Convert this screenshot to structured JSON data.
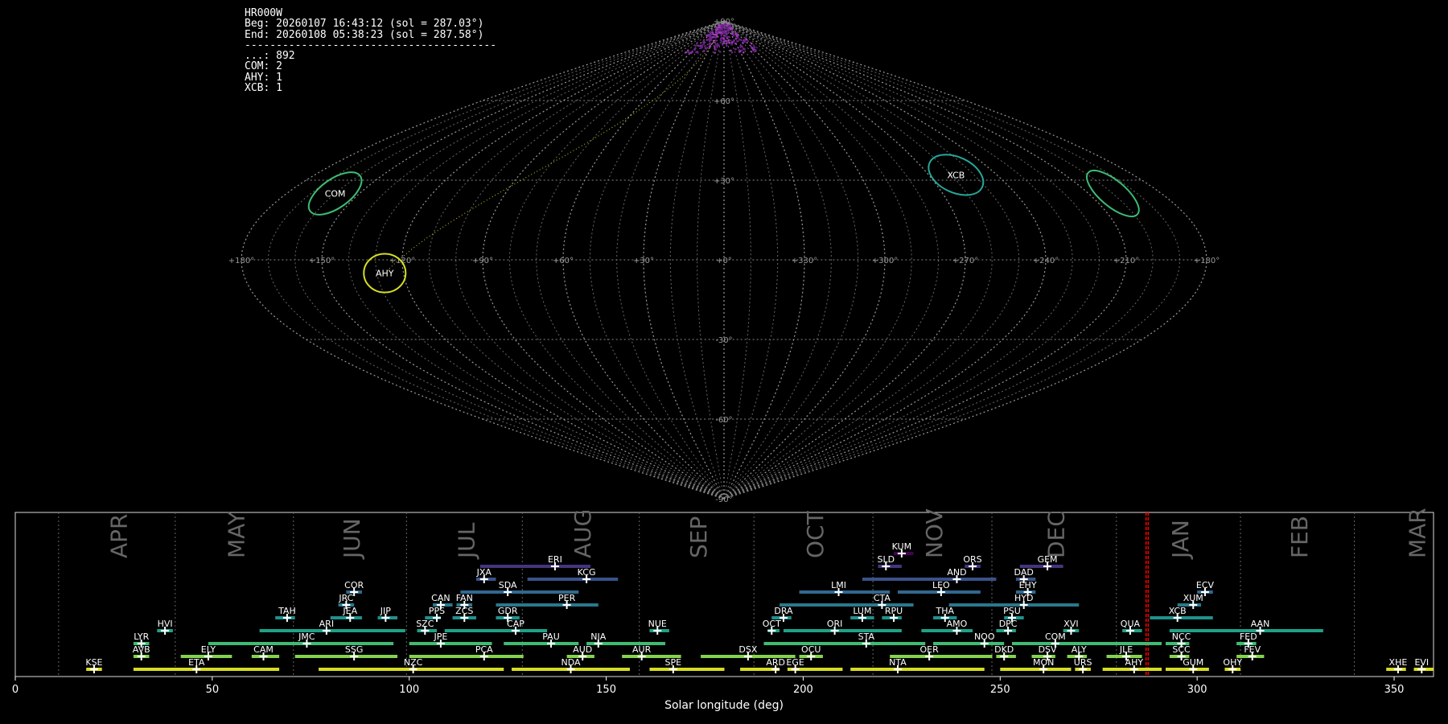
{
  "info": {
    "header_lines": [
      "HR000W",
      "Beg: 20260107 16:43:12 (sol = 287.03°)",
      "End: 20260108 05:38:23 (sol = 287.58°)",
      "----------------------------------------"
    ],
    "counts": [
      {
        "code": "...",
        "count": 892
      },
      {
        "code": "COM",
        "count": 2
      },
      {
        "code": "AHY",
        "count": 1
      },
      {
        "code": "XCB",
        "count": 1
      }
    ]
  },
  "sky_map": {
    "projection": "sinusoidal",
    "lon_ticks": [
      "+180°",
      "+150°",
      "+120°",
      "+90°",
      "+60°",
      "+30°",
      "+0°",
      "+330°",
      "+300°",
      "+270°",
      "+240°",
      "+210°",
      "+180°"
    ],
    "lat_ticks": [
      "+90°",
      "+60°",
      "+30°",
      "-30°",
      "-60°",
      "-90°"
    ],
    "radiants": [
      {
        "code": "COM",
        "lon": 160,
        "lat": 25,
        "color": "#3dbc74"
      },
      {
        "code": "AHY",
        "lon": 127,
        "lat": -5,
        "color": "#d6dd22"
      },
      {
        "code": "XCB",
        "lon": 258,
        "lat": 32,
        "color": "#26a69a"
      },
      {
        "code": "",
        "lon": 200,
        "lat": 25,
        "color": "#3dbc74"
      }
    ]
  },
  "timeline": {
    "month_labels": [
      "APR",
      "MAY",
      "JUN",
      "JUL",
      "AUG",
      "SEP",
      "OCT",
      "NOV",
      "DEC",
      "JAN",
      "FEB",
      "MAR"
    ],
    "month_boundaries": [
      11.0,
      40.6,
      70.6,
      99.3,
      128.7,
      158.4,
      187.5,
      217.7,
      247.9,
      279.5,
      311.0,
      339.9
    ],
    "current_sol": [
      287.03,
      287.58
    ]
  },
  "chart_data": {
    "type": "timeline",
    "xlabel": "Solar longitude (deg)",
    "xlim": [
      0,
      360
    ],
    "xticks": [
      0,
      50,
      100,
      150,
      200,
      250,
      300,
      350
    ],
    "showers": [
      {
        "code": "KSE",
        "start": 18,
        "end": 22,
        "peak": 20,
        "row": 0,
        "color": "#d6dd22"
      },
      {
        "code": "ETA",
        "start": 30,
        "end": 67,
        "peak": 46,
        "row": 0,
        "color": "#d6dd22"
      },
      {
        "code": "NZC",
        "start": 77,
        "end": 124,
        "peak": 101,
        "row": 0,
        "color": "#d6dd22"
      },
      {
        "code": "NDA",
        "start": 126,
        "end": 156,
        "peak": 141,
        "row": 0,
        "color": "#d6dd22"
      },
      {
        "code": "SPE",
        "start": 161,
        "end": 180,
        "peak": 167,
        "row": 0,
        "color": "#d6dd22"
      },
      {
        "code": "ARD",
        "start": 184,
        "end": 194,
        "peak": 193,
        "row": 0,
        "color": "#d6dd22"
      },
      {
        "code": "EGE",
        "start": 196,
        "end": 210,
        "peak": 198,
        "row": 0,
        "color": "#d6dd22"
      },
      {
        "code": "NTA",
        "start": 212,
        "end": 246,
        "peak": 224,
        "row": 0,
        "color": "#d6dd22"
      },
      {
        "code": "MON",
        "start": 250,
        "end": 268,
        "peak": 261,
        "row": 0,
        "color": "#d6dd22"
      },
      {
        "code": "URS",
        "start": 269,
        "end": 273,
        "peak": 271,
        "row": 0,
        "color": "#d6dd22"
      },
      {
        "code": "AHY",
        "start": 276,
        "end": 291,
        "peak": 284,
        "row": 0,
        "color": "#d6dd22"
      },
      {
        "code": "GUM",
        "start": 292,
        "end": 303,
        "peak": 299,
        "row": 0,
        "color": "#d6dd22"
      },
      {
        "code": "OHY",
        "start": 307,
        "end": 311,
        "peak": 309,
        "row": 0,
        "color": "#d6dd22"
      },
      {
        "code": "XHE",
        "start": 348,
        "end": 353,
        "peak": 351,
        "row": 0,
        "color": "#d6dd22"
      },
      {
        "code": "EVI",
        "start": 355,
        "end": 360,
        "peak": 357,
        "row": 0,
        "color": "#d6dd22"
      },
      {
        "code": "AVB",
        "start": 30,
        "end": 34,
        "peak": 32,
        "row": 1,
        "color": "#84d44b"
      },
      {
        "code": "ELY",
        "start": 42,
        "end": 55,
        "peak": 49,
        "row": 1,
        "color": "#84d44b"
      },
      {
        "code": "CAM",
        "start": 60,
        "end": 67,
        "peak": 63,
        "row": 1,
        "color": "#84d44b"
      },
      {
        "code": "SSG",
        "start": 71,
        "end": 97,
        "peak": 86,
        "row": 1,
        "color": "#84d44b"
      },
      {
        "code": "PCA",
        "start": 100,
        "end": 129,
        "peak": 119,
        "row": 1,
        "color": "#84d44b"
      },
      {
        "code": "AUD",
        "start": 140,
        "end": 147,
        "peak": 144,
        "row": 1,
        "color": "#84d44b"
      },
      {
        "code": "AUR",
        "start": 154,
        "end": 169,
        "peak": 159,
        "row": 1,
        "color": "#84d44b"
      },
      {
        "code": "DSX",
        "start": 174,
        "end": 198,
        "peak": 186,
        "row": 1,
        "color": "#84d44b"
      },
      {
        "code": "OCU",
        "start": 199,
        "end": 205,
        "peak": 202,
        "row": 1,
        "color": "#84d44b"
      },
      {
        "code": "OER",
        "start": 222,
        "end": 248,
        "peak": 232,
        "row": 1,
        "color": "#84d44b"
      },
      {
        "code": "DKD",
        "start": 249,
        "end": 254,
        "peak": 251,
        "row": 1,
        "color": "#84d44b"
      },
      {
        "code": "DSV",
        "start": 258,
        "end": 264,
        "peak": 262,
        "row": 1,
        "color": "#84d44b"
      },
      {
        "code": "ALY",
        "start": 267,
        "end": 272,
        "peak": 270,
        "row": 1,
        "color": "#84d44b"
      },
      {
        "code": "JLE",
        "start": 277,
        "end": 286,
        "peak": 282,
        "row": 1,
        "color": "#84d44b"
      },
      {
        "code": "SCC",
        "start": 293,
        "end": 298,
        "peak": 296,
        "row": 1,
        "color": "#84d44b"
      },
      {
        "code": "FEV",
        "start": 310,
        "end": 317,
        "peak": 314,
        "row": 1,
        "color": "#84d44b"
      },
      {
        "code": "LYR",
        "start": 30,
        "end": 34,
        "peak": 32,
        "row": 2,
        "color": "#3dbc74"
      },
      {
        "code": "JMC",
        "start": 49,
        "end": 96,
        "peak": 74,
        "row": 2,
        "color": "#3dbc74"
      },
      {
        "code": "JPE",
        "start": 100,
        "end": 121,
        "peak": 108,
        "row": 2,
        "color": "#3dbc74"
      },
      {
        "code": "PAU",
        "start": 124,
        "end": 143,
        "peak": 136,
        "row": 2,
        "color": "#3dbc74"
      },
      {
        "code": "NIA",
        "start": 145,
        "end": 165,
        "peak": 148,
        "row": 2,
        "color": "#3dbc74"
      },
      {
        "code": "STA",
        "start": 190,
        "end": 231,
        "peak": 216,
        "row": 2,
        "color": "#3dbc74"
      },
      {
        "code": "NOO",
        "start": 233,
        "end": 251,
        "peak": 246,
        "row": 2,
        "color": "#3dbc74"
      },
      {
        "code": "COM",
        "start": 253,
        "end": 291,
        "peak": 264,
        "row": 2,
        "color": "#3dbc74"
      },
      {
        "code": "NCC",
        "start": 292,
        "end": 298,
        "peak": 296,
        "row": 2,
        "color": "#3dbc74"
      },
      {
        "code": "FED",
        "start": 310,
        "end": 315,
        "peak": 313,
        "row": 2,
        "color": "#3dbc74"
      },
      {
        "code": "HVI",
        "start": 36,
        "end": 40,
        "peak": 38,
        "row": 3,
        "color": "#1fa187"
      },
      {
        "code": "ARI",
        "start": 62,
        "end": 99,
        "peak": 79,
        "row": 3,
        "color": "#1fa187"
      },
      {
        "code": "SZC",
        "start": 102,
        "end": 107,
        "peak": 104,
        "row": 3,
        "color": "#1fa187"
      },
      {
        "code": "CAP",
        "start": 109,
        "end": 135,
        "peak": 127,
        "row": 3,
        "color": "#1fa187"
      },
      {
        "code": "NUE",
        "start": 161,
        "end": 166,
        "peak": 163,
        "row": 3,
        "color": "#1fa187"
      },
      {
        "code": "OCT",
        "start": 191,
        "end": 194,
        "peak": 192,
        "row": 3,
        "color": "#1fa187"
      },
      {
        "code": "ORI",
        "start": 195,
        "end": 225,
        "peak": 208,
        "row": 3,
        "color": "#1fa187"
      },
      {
        "code": "AMO",
        "start": 230,
        "end": 243,
        "peak": 239,
        "row": 3,
        "color": "#1fa187"
      },
      {
        "code": "DPC",
        "start": 249,
        "end": 254,
        "peak": 252,
        "row": 3,
        "color": "#1fa187"
      },
      {
        "code": "XVI",
        "start": 266,
        "end": 270,
        "peak": 268,
        "row": 3,
        "color": "#1fa187"
      },
      {
        "code": "QUA",
        "start": 281,
        "end": 286,
        "peak": 283,
        "row": 3,
        "color": "#1fa187"
      },
      {
        "code": "AAN",
        "start": 293,
        "end": 332,
        "peak": 316,
        "row": 3,
        "color": "#1fa187"
      },
      {
        "code": "TAH",
        "start": 66,
        "end": 71,
        "peak": 69,
        "row": 4,
        "color": "#21918c"
      },
      {
        "code": "JEA",
        "start": 80,
        "end": 88,
        "peak": 85,
        "row": 4,
        "color": "#21918c"
      },
      {
        "code": "JIP",
        "start": 92,
        "end": 97,
        "peak": 94,
        "row": 4,
        "color": "#21918c"
      },
      {
        "code": "PPS",
        "start": 104,
        "end": 108,
        "peak": 107,
        "row": 4,
        "color": "#21918c"
      },
      {
        "code": "ZCS",
        "start": 111,
        "end": 117,
        "peak": 114,
        "row": 4,
        "color": "#21918c"
      },
      {
        "code": "GDR",
        "start": 122,
        "end": 128,
        "peak": 125,
        "row": 4,
        "color": "#21918c"
      },
      {
        "code": "DRA",
        "start": 192,
        "end": 197,
        "peak": 195,
        "row": 4,
        "color": "#21918c"
      },
      {
        "code": "LUM",
        "start": 212,
        "end": 218,
        "peak": 215,
        "row": 4,
        "color": "#21918c"
      },
      {
        "code": "RPU",
        "start": 220,
        "end": 225,
        "peak": 223,
        "row": 4,
        "color": "#21918c"
      },
      {
        "code": "THA",
        "start": 233,
        "end": 239,
        "peak": 236,
        "row": 4,
        "color": "#21918c"
      },
      {
        "code": "PSU",
        "start": 251,
        "end": 256,
        "peak": 253,
        "row": 4,
        "color": "#21918c"
      },
      {
        "code": "XCB",
        "start": 288,
        "end": 304,
        "peak": 295,
        "row": 4,
        "color": "#21918c"
      },
      {
        "code": "JRC",
        "start": 82,
        "end": 86,
        "peak": 84,
        "row": 5,
        "color": "#2a788e"
      },
      {
        "code": "CAN",
        "start": 106,
        "end": 111,
        "peak": 108,
        "row": 5,
        "color": "#2a788e"
      },
      {
        "code": "FAN",
        "start": 112,
        "end": 116,
        "peak": 114,
        "row": 5,
        "color": "#2a788e"
      },
      {
        "code": "PER",
        "start": 122,
        "end": 148,
        "peak": 140,
        "row": 5,
        "color": "#2a788e"
      },
      {
        "code": "CTA",
        "start": 194,
        "end": 228,
        "peak": 220,
        "row": 5,
        "color": "#2a788e"
      },
      {
        "code": "HYD",
        "start": 237,
        "end": 270,
        "peak": 256,
        "row": 5,
        "color": "#2a788e"
      },
      {
        "code": "XUM",
        "start": 295,
        "end": 301,
        "peak": 299,
        "row": 5,
        "color": "#2a788e"
      },
      {
        "code": "COR",
        "start": 84,
        "end": 88,
        "peak": 86,
        "row": 6,
        "color": "#31688e"
      },
      {
        "code": "SDA",
        "start": 113,
        "end": 143,
        "peak": 125,
        "row": 6,
        "color": "#31688e"
      },
      {
        "code": "LMI",
        "start": 199,
        "end": 222,
        "peak": 209,
        "row": 6,
        "color": "#31688e"
      },
      {
        "code": "LEO",
        "start": 224,
        "end": 245,
        "peak": 235,
        "row": 6,
        "color": "#31688e"
      },
      {
        "code": "EHY",
        "start": 254,
        "end": 259,
        "peak": 257,
        "row": 6,
        "color": "#31688e"
      },
      {
        "code": "ECV",
        "start": 300,
        "end": 304,
        "peak": 302,
        "row": 6,
        "color": "#31688e"
      },
      {
        "code": "JXA",
        "start": 117,
        "end": 122,
        "peak": 119,
        "row": 7,
        "color": "#3b528b"
      },
      {
        "code": "KCG",
        "start": 130,
        "end": 153,
        "peak": 145,
        "row": 7,
        "color": "#3b528b"
      },
      {
        "code": "AND",
        "start": 215,
        "end": 249,
        "peak": 239,
        "row": 7,
        "color": "#3b528b"
      },
      {
        "code": "DAD",
        "start": 254,
        "end": 259,
        "peak": 256,
        "row": 7,
        "color": "#3b528b"
      },
      {
        "code": "ERI",
        "start": 118,
        "end": 146,
        "peak": 137,
        "row": 8,
        "color": "#463480"
      },
      {
        "code": "SLD",
        "start": 219,
        "end": 225,
        "peak": 221,
        "row": 8,
        "color": "#463480"
      },
      {
        "code": "ORS",
        "start": 241,
        "end": 245,
        "peak": 243,
        "row": 8,
        "color": "#463480"
      },
      {
        "code": "GEM",
        "start": 255,
        "end": 266,
        "peak": 262,
        "row": 8,
        "color": "#463480"
      },
      {
        "code": "KUM",
        "start": 223,
        "end": 228,
        "peak": 225,
        "row": 9,
        "color": "#440154"
      }
    ]
  }
}
